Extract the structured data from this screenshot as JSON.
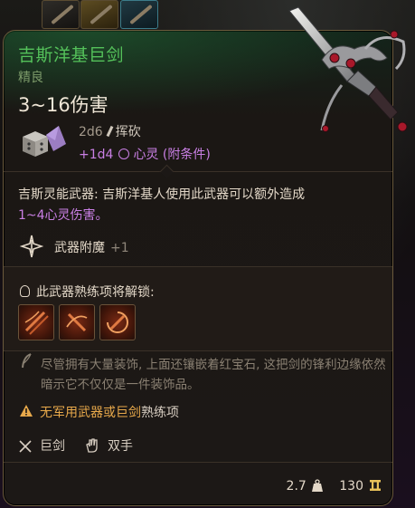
{
  "item": {
    "name": "吉斯洋基巨剑",
    "rarity": "精良",
    "damage_range": "3~16伤害",
    "damage_lines": [
      {
        "dice": "2d6",
        "type": "挥砍"
      },
      {
        "dice": "+1d4",
        "type": "心灵 (附条件)"
      }
    ],
    "description_line1": "吉斯灵能武器: 吉斯洋基人使用此武器可以额外造成",
    "description_line2": "1~4心灵伤害。",
    "enchantment": {
      "label": "武器附魔",
      "value": "+1"
    },
    "proficiency_header": "此武器熟练项将解锁:",
    "proficiency_actions": [
      "action-1",
      "action-2",
      "action-3"
    ],
    "lore": "尽管拥有大量装饰, 上面还镶嵌着红宝石, 这把剑的锋利边缘依然暗示它不仅仅是一件装饰品。",
    "warning": {
      "highlight": "无军用武器或巨剑",
      "rest": "熟练项"
    },
    "properties": [
      {
        "label": "巨剑",
        "icon": "crossed-swords-icon"
      },
      {
        "label": "双手",
        "icon": "hand-icon"
      }
    ],
    "weight": "2.7",
    "value": "130"
  },
  "colors": {
    "title": "#54c15a",
    "psychic": "#c97fe4",
    "warning": "#e8a94b"
  }
}
